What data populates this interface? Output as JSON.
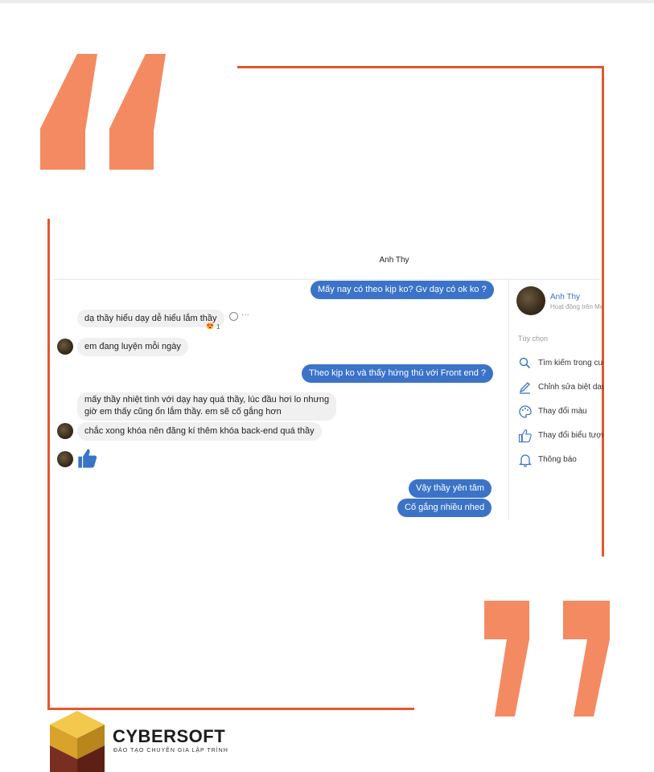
{
  "chat": {
    "title": "Anh Thy",
    "messages": [
      {
        "dir": "out",
        "text": "Mấy nay có theo kịp ko? Gv dạy có ok ko ?"
      },
      {
        "dir": "in",
        "text": "dạ thầy hiểu dạy dễ hiểu lắm thầy"
      },
      {
        "dir": "in",
        "text": "em đang luyện mỗi ngày"
      },
      {
        "dir": "out",
        "text": "Theo kịp ko và thấy hứng thú với Front end ?"
      },
      {
        "dir": "in",
        "text": "mấy thầy nhiệt tình với dạy hay quá thầy, lúc đầu hơi lo nhưng"
      },
      {
        "dir": "in",
        "text": "giờ em thấy cũng ổn lắm thầy. em sẽ cố gắng hơn"
      },
      {
        "dir": "in",
        "text": "chắc xong khóa nên đăng kí thêm khóa back-end quá thầy"
      },
      {
        "dir": "out",
        "text": "Vậy thầy yên tâm"
      },
      {
        "dir": "out",
        "text": "Cố gắng nhiều nhed"
      }
    ],
    "reaction": {
      "emoji": "😍",
      "count": "1"
    },
    "more_icon": "···"
  },
  "sidebar": {
    "name": "Anh Thy",
    "status": "Hoạt động trên Messenger",
    "options_label": "Tùy chọn",
    "items": [
      {
        "icon": "search-icon",
        "label": "Tìm kiếm trong cuộc trò chuyện"
      },
      {
        "icon": "pencil-icon",
        "label": "Chỉnh sửa biệt danh"
      },
      {
        "icon": "palette-icon",
        "label": "Thay đổi màu"
      },
      {
        "icon": "thumbs-up-icon",
        "label": "Thay đổi biểu tượng cảm xúc"
      },
      {
        "icon": "bell-icon",
        "label": "Thông báo"
      }
    ]
  },
  "brand": {
    "name": "CYBERSOFT",
    "tagline": "ĐÀO TẠO CHUYÊN GIA LẬP TRÌNH"
  },
  "colors": {
    "accent": "#e4572e",
    "quote": "#f48a62",
    "outgoing_bubble": "#3b73c8",
    "incoming_bubble": "#f0f0f0",
    "link": "#3b73c8"
  }
}
